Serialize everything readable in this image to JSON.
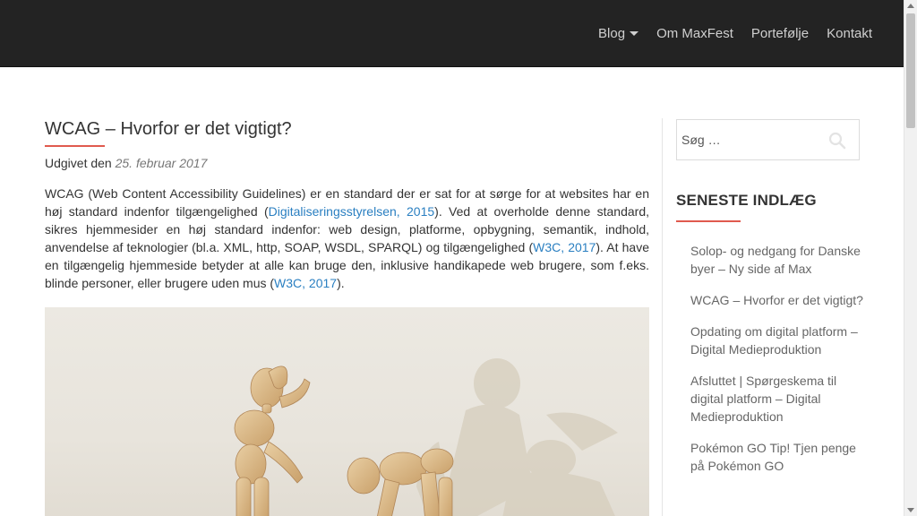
{
  "nav": {
    "items": [
      {
        "label": "Blog",
        "has_dropdown": true
      },
      {
        "label": "Om MaxFest",
        "has_dropdown": false
      },
      {
        "label": "Portefølje",
        "has_dropdown": false
      },
      {
        "label": "Kontakt",
        "has_dropdown": false
      }
    ]
  },
  "post": {
    "title": "WCAG – Hvorfor er det vigtigt?",
    "meta_prefix": "Udgivet den",
    "date": "25. februar 2017",
    "body": {
      "t1": "WCAG (Web Content Accessibility Guidelines) er en standard der er sat for at sørge for at websites har en høj standard indenfor tilgængelighed (",
      "link1": "Digitaliseringsstyrelsen, 2015",
      "t2": "). Ved at overholde denne standard, sikres hjemmesider en høj standard indenfor: web design, platforme, opbygning, semantik, indhold, anvendelse af teknologier (bl.a. XML, http, SOAP, WSDL, SPARQL) og tilgængelighed (",
      "link2": "W3C, 2017",
      "t3": "). At have en tilgængelig hjemmeside betyder at alle kan bruge den, inklusive handikapede web brugere, som f.eks. blinde personer, eller brugere uden mus (",
      "link3": "W3C, 2017",
      "t4": ")."
    },
    "image_icon": "wooden-mannequins-image"
  },
  "sidebar": {
    "search": {
      "placeholder": "Søg …",
      "icon": "search-icon"
    },
    "recent_title": "SENESTE INDLÆG",
    "recent_posts": [
      "Solop- og nedgang for Danske byer – Ny side af Max",
      "WCAG – Hvorfor er det vigtigt?",
      "Opdating om digital platform – Digital Medieproduktion",
      "Afsluttet | Spørgeskema til digital platform – Digital Medieproduktion",
      "Pokémon GO Tip! Tjen penge på Pokémon GO"
    ]
  },
  "colors": {
    "header_bg": "#232323",
    "accent": "#e05a4e",
    "link": "#2a7fc1"
  }
}
